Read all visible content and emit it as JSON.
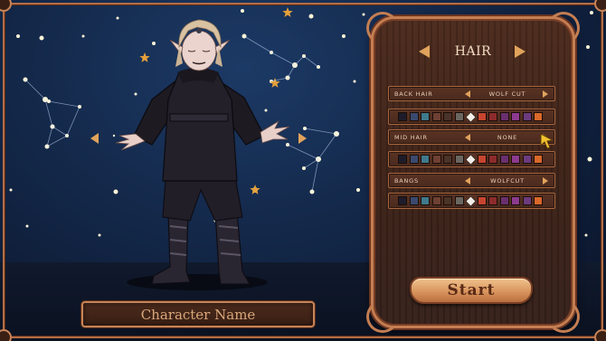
{
  "screen": {
    "name_field": {
      "placeholder": "Character Name"
    },
    "panel": {
      "title": "HAIR",
      "options": [
        {
          "label": "BACK HAIR",
          "value": "WOLF CUT"
        },
        {
          "label": "MID HAIR",
          "value": "NONE"
        },
        {
          "label": "BANGS",
          "value": "WOLFCUT"
        }
      ],
      "palette": [
        "#1e1c2a",
        "#3a4a6e",
        "#3f7a8c",
        "#6d4033",
        "#4a3328",
        "#6a6660",
        "#f3f0ea",
        "#c7452f",
        "#8c2b2b",
        "#6a2f6f",
        "#8c3a8f",
        "#6c3b7e",
        "#d9682a"
      ],
      "selected_swatch_index": 6,
      "start_label": "Start"
    },
    "colors": {
      "frame_copper": "#c47e52",
      "panel_wood": "#3d2217",
      "accent_gold": "#e1a35c",
      "sky": "#14294b"
    },
    "icons": [
      "chevron-left-icon",
      "chevron-right-icon",
      "pointer-cursor-icon",
      "star-icon"
    ]
  }
}
